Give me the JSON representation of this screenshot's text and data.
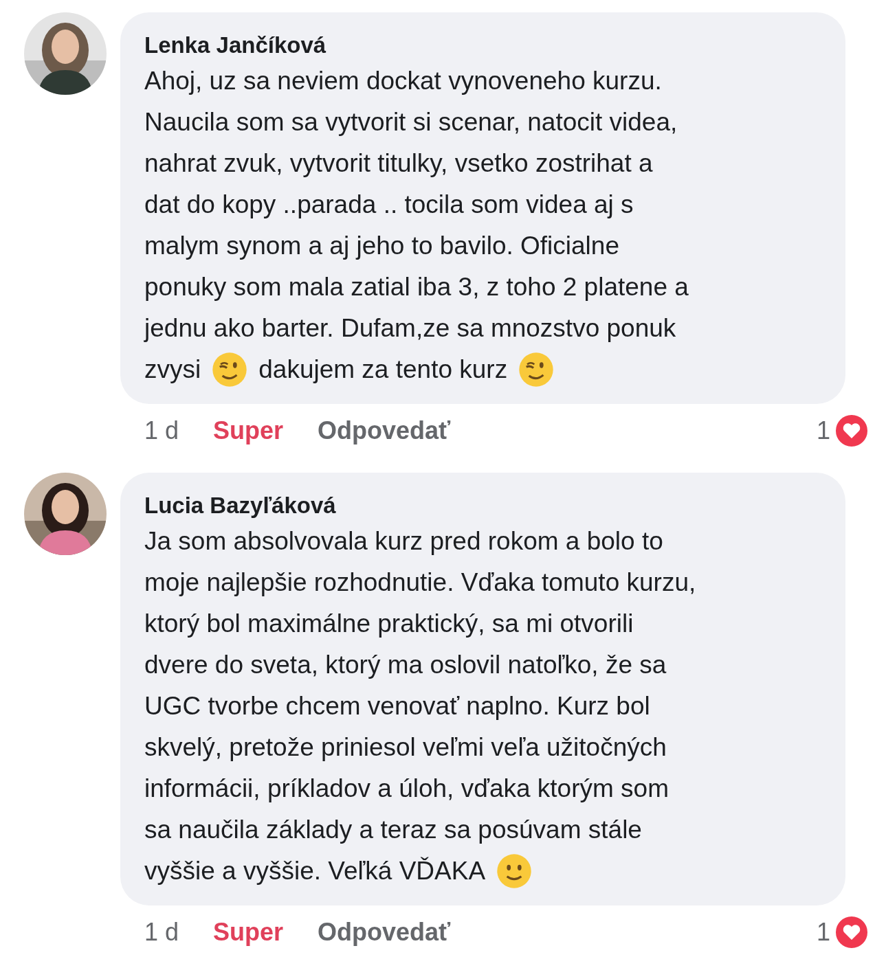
{
  "comments": [
    {
      "author": "Lenka Jančíková",
      "avatar": {
        "kind": "picture"
      },
      "lines": [
        [
          {
            "kind": "text",
            "text": "Ahoj, uz sa neviem dockat vynoveneho kurzu."
          }
        ],
        [
          {
            "kind": "text",
            "text": "Naucila som sa vytvorit si scenar, natocit videa,"
          }
        ],
        [
          {
            "kind": "text",
            "text": "nahrat zvuk, vytvorit titulky, vsetko zostrihat a"
          }
        ],
        [
          {
            "kind": "text",
            "text": "dat do kopy ..parada .. tocila som videa aj s"
          }
        ],
        [
          {
            "kind": "text",
            "text": "malym synom a aj jeho to bavilo. Oficialne"
          }
        ],
        [
          {
            "kind": "text",
            "text": "ponuky som mala zatial iba 3, z toho 2 platene a"
          }
        ],
        [
          {
            "kind": "text",
            "text": "jednu ako barter. Dufam,ze sa mnozstvo ponuk"
          }
        ],
        [
          {
            "kind": "text",
            "text": "zvysi"
          },
          {
            "kind": "wink"
          },
          {
            "kind": "text",
            "text": "dakujem za tento kurz"
          },
          {
            "kind": "wink"
          }
        ]
      ],
      "time": "1 d",
      "react_label": "Super",
      "reacted": true,
      "reply_label": "Odpovedať",
      "reaction_count": "1"
    },
    {
      "author": "Lucia Bazyľáková",
      "avatar": {
        "kind": "picture"
      },
      "lines": [
        [
          {
            "kind": "text",
            "text": "Ja som absolvovala kurz pred rokom a bolo to"
          }
        ],
        [
          {
            "kind": "text",
            "text": "moje najlepšie rozhodnutie. Vďaka tomuto kurzu,"
          }
        ],
        [
          {
            "kind": "text",
            "text": "ktorý bol maximálne praktický, sa mi otvorili"
          }
        ],
        [
          {
            "kind": "text",
            "text": "dvere do sveta, ktorý ma oslovil natoľko, že sa"
          }
        ],
        [
          {
            "kind": "text",
            "text": "UGC tvorbe chcem venovať naplno. Kurz bol"
          }
        ],
        [
          {
            "kind": "text",
            "text": "skvelý, pretože priniesol veľmi veľa užitočných"
          }
        ],
        [
          {
            "kind": "text",
            "text": "informácii, príkladov a úloh, vďaka ktorým som"
          }
        ],
        [
          {
            "kind": "text",
            "text": "sa naučila základy a teraz sa posúvam stále"
          }
        ],
        [
          {
            "kind": "text",
            "text": "vyššie a vyššie. Veľká VĎAKA"
          },
          {
            "kind": "smile"
          }
        ]
      ],
      "time": "1 d",
      "react_label": "Super",
      "reacted": true,
      "reply_label": "Odpovedať",
      "reaction_count": "1"
    }
  ]
}
